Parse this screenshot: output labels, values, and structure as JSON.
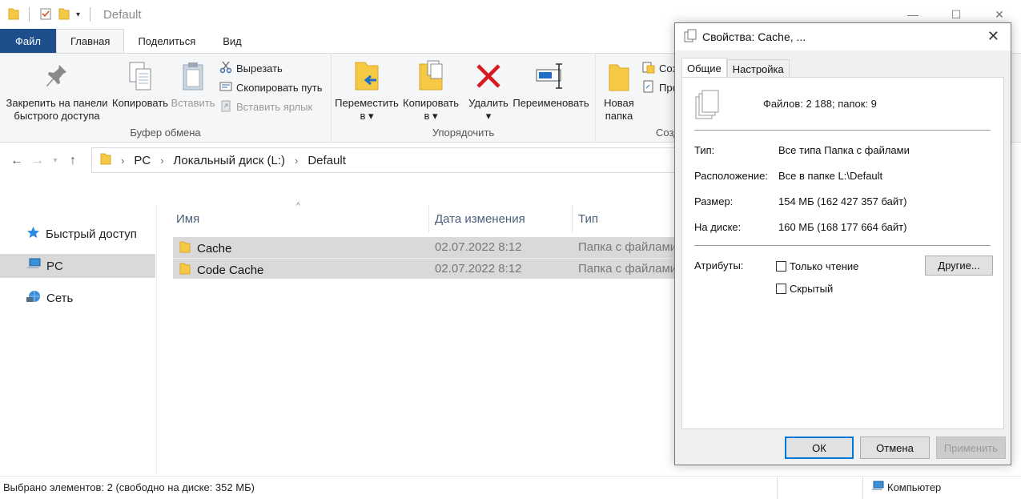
{
  "window": {
    "title": "Default",
    "controls": {
      "minimize": "—",
      "maximize": "☐",
      "close": "✕"
    }
  },
  "ribbon_tabs": [
    "Файл",
    "Главная",
    "Поделиться",
    "Вид"
  ],
  "ribbon": {
    "clipboard": {
      "label": "Буфер обмена",
      "pin_line1": "Закрепить на панели",
      "pin_line2": "быстрого доступа",
      "copy": "Копировать",
      "paste": "Вставить",
      "cut": "Вырезать",
      "copy_path": "Скопировать путь",
      "paste_shortcut": "Вставить ярлык"
    },
    "organize": {
      "label": "Упорядочить",
      "move_line1": "Переместить",
      "move_line2": "в ▾",
      "copyto_line1": "Копировать",
      "copyto_line2": "в ▾",
      "delete_line1": "Удалить",
      "delete_line2": "▾",
      "rename": "Переименовать"
    },
    "create": {
      "label": "Созд",
      "new_folder_line1": "Новая",
      "new_folder_line2": "папка",
      "item1": "Соз",
      "item2": "Про"
    }
  },
  "address": {
    "crumbs": [
      "PC",
      "Локальный диск (L:)",
      "Default"
    ],
    "sep": "›"
  },
  "nav": {
    "quick": "Быстрый доступ",
    "pc": "PC",
    "network": "Сеть"
  },
  "columns": {
    "name": "Имя",
    "date": "Дата изменения",
    "type": "Тип",
    "sort_arrow": "^"
  },
  "files": [
    {
      "name": "Cache",
      "date": "02.07.2022 8:12",
      "type": "Папка с файлами"
    },
    {
      "name": "Code Cache",
      "date": "02.07.2022 8:12",
      "type": "Папка с файлами"
    }
  ],
  "status": {
    "text": "Выбрано элементов: 2 (свободно на диске: 352 МБ)",
    "computer": "Компьютер"
  },
  "dialog": {
    "title": "Свойства: Cache, ...",
    "close": "✕",
    "tabs": [
      "Общие",
      "Настройка"
    ],
    "summary": "Файлов: 2 188; папок: 9",
    "rows": [
      {
        "label": "Тип:",
        "value": "Все типа Папка с файлами"
      },
      {
        "label": "Расположение:",
        "value": "Все в папке L:\\Default"
      },
      {
        "label": "Размер:",
        "value": "154 МБ (162 427 357 байт)"
      },
      {
        "label": "На диске:",
        "value": "160 МБ (168 177 664 байт)"
      }
    ],
    "attributes_label": "Атрибуты:",
    "readonly": "Только чтение",
    "hidden": "Скрытый",
    "other_btn": "Другие...",
    "ok": "ОК",
    "cancel": "Отмена",
    "apply": "Применить"
  },
  "colors": {
    "file_tab": "#1e4e8c",
    "selection": "#d9d9d9",
    "primary_border": "#0078d7",
    "delete_red": "#d71920",
    "folder_yellow": "#f6c945"
  }
}
